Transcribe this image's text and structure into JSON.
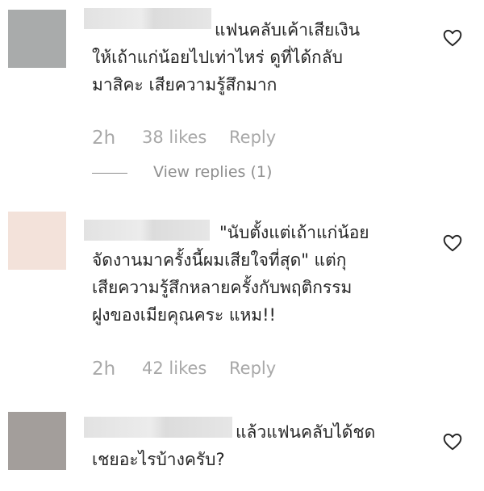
{
  "comments": [
    {
      "lines": [
        "แฟนคลับเค้าเสียเงิน",
        "ให้เถ้าแก่น้อยไปเท่าไหร่ ดูที่ได้กลับ",
        "มาสิคะ เสียความรู้สึกมาก"
      ],
      "time": "2h",
      "likes": "38 likes",
      "reply_label": "Reply",
      "view_replies": "View replies (1)",
      "avatar_color": "#a9abab"
    },
    {
      "lines": [
        "\"นับตั้งแต่เถ้าแก่น้อย",
        "จัดงานมาครั้งนี้ผมเสียใจที่สุด\" แต่กุ",
        "เสียความรู้สึกหลายครั้งกับพฤติกรรม",
        "ฝูงของเมียคุณคระ แหม!!"
      ],
      "time": "2h",
      "likes": "42 likes",
      "reply_label": "Reply",
      "avatar_color": "#f3e2da"
    },
    {
      "lines": [
        "แล้วแฟนคลับได้ชด",
        "เชยอะไรบ้างครับ?"
      ],
      "avatar_color": "#a39e9b"
    }
  ],
  "icons": {
    "like": "heart-outline-icon"
  }
}
